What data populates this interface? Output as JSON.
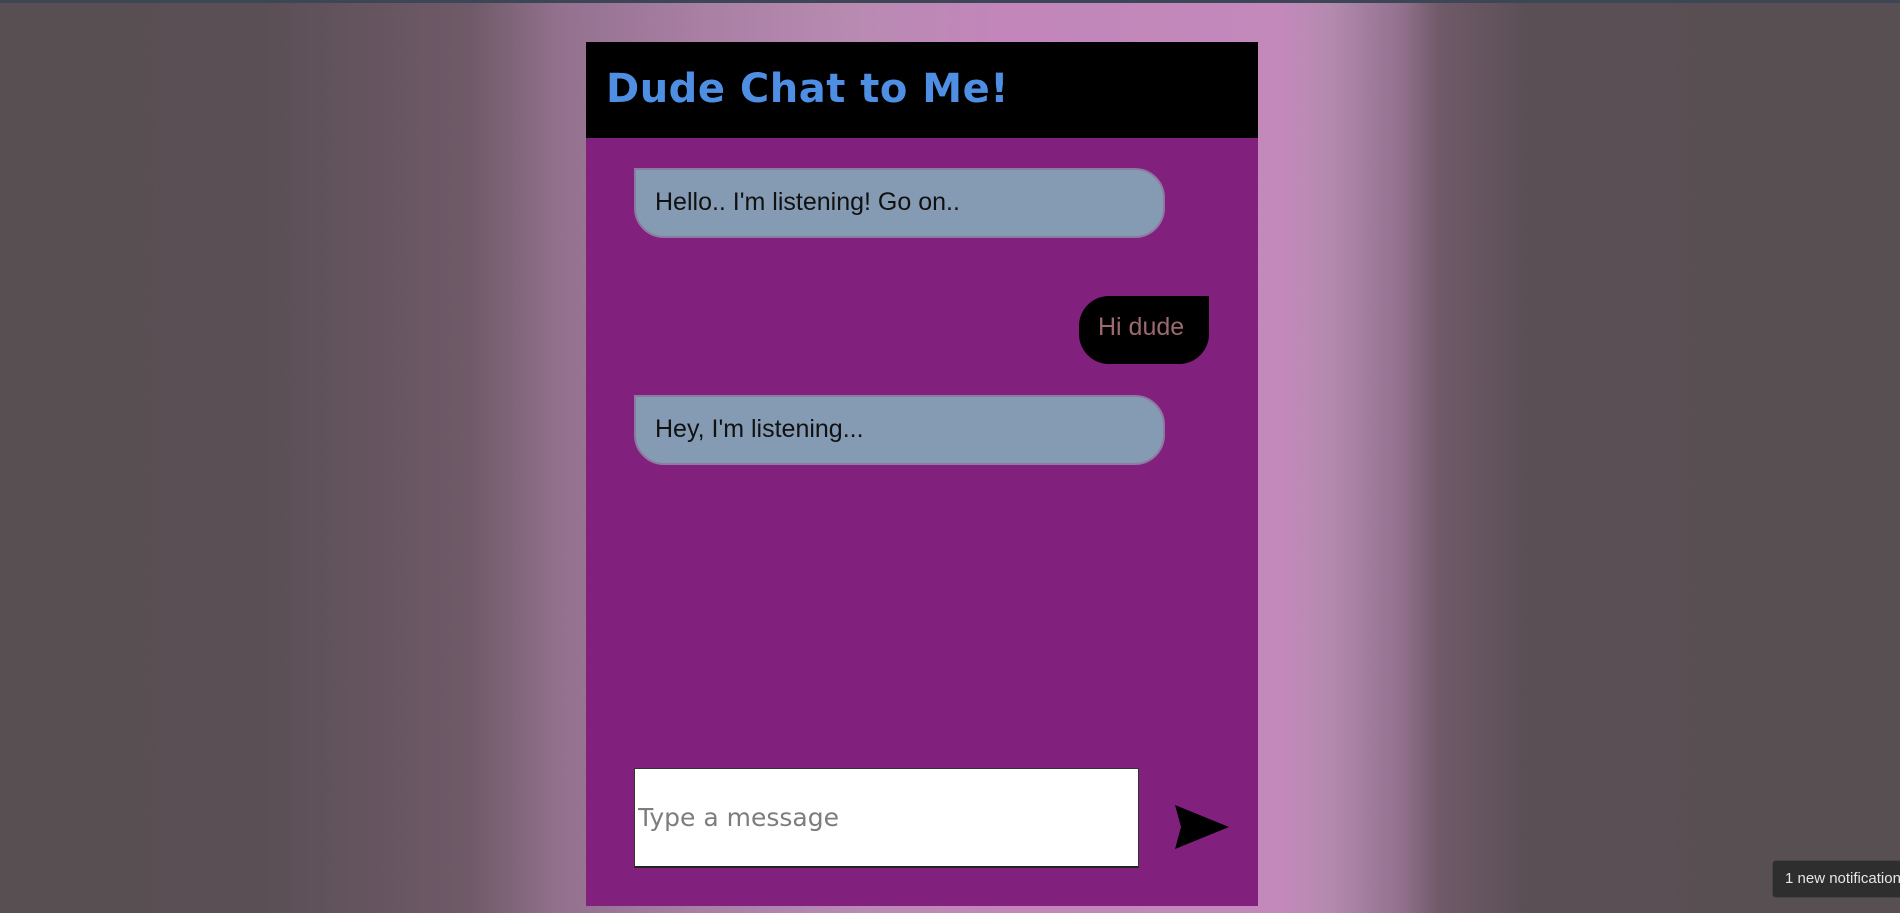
{
  "app": {
    "title": "Dude Chat to Me!"
  },
  "messages": [
    {
      "sender": "bot",
      "text": "Hello.. I'm listening! Go on.."
    },
    {
      "sender": "user",
      "text": "Hi dude"
    },
    {
      "sender": "bot",
      "text": "Hey, I'm listening..."
    }
  ],
  "composer": {
    "placeholder": "Type a message",
    "value": "",
    "send_icon": "send-arrow-icon"
  },
  "notification": {
    "text": "1 new notification"
  },
  "colors": {
    "header_bg": "#000000",
    "title": "#4f8fe3",
    "chat_bg": "#82207e",
    "bot_bubble": "#849bb3",
    "user_bubble": "#000000",
    "user_text": "#9a6a70"
  }
}
